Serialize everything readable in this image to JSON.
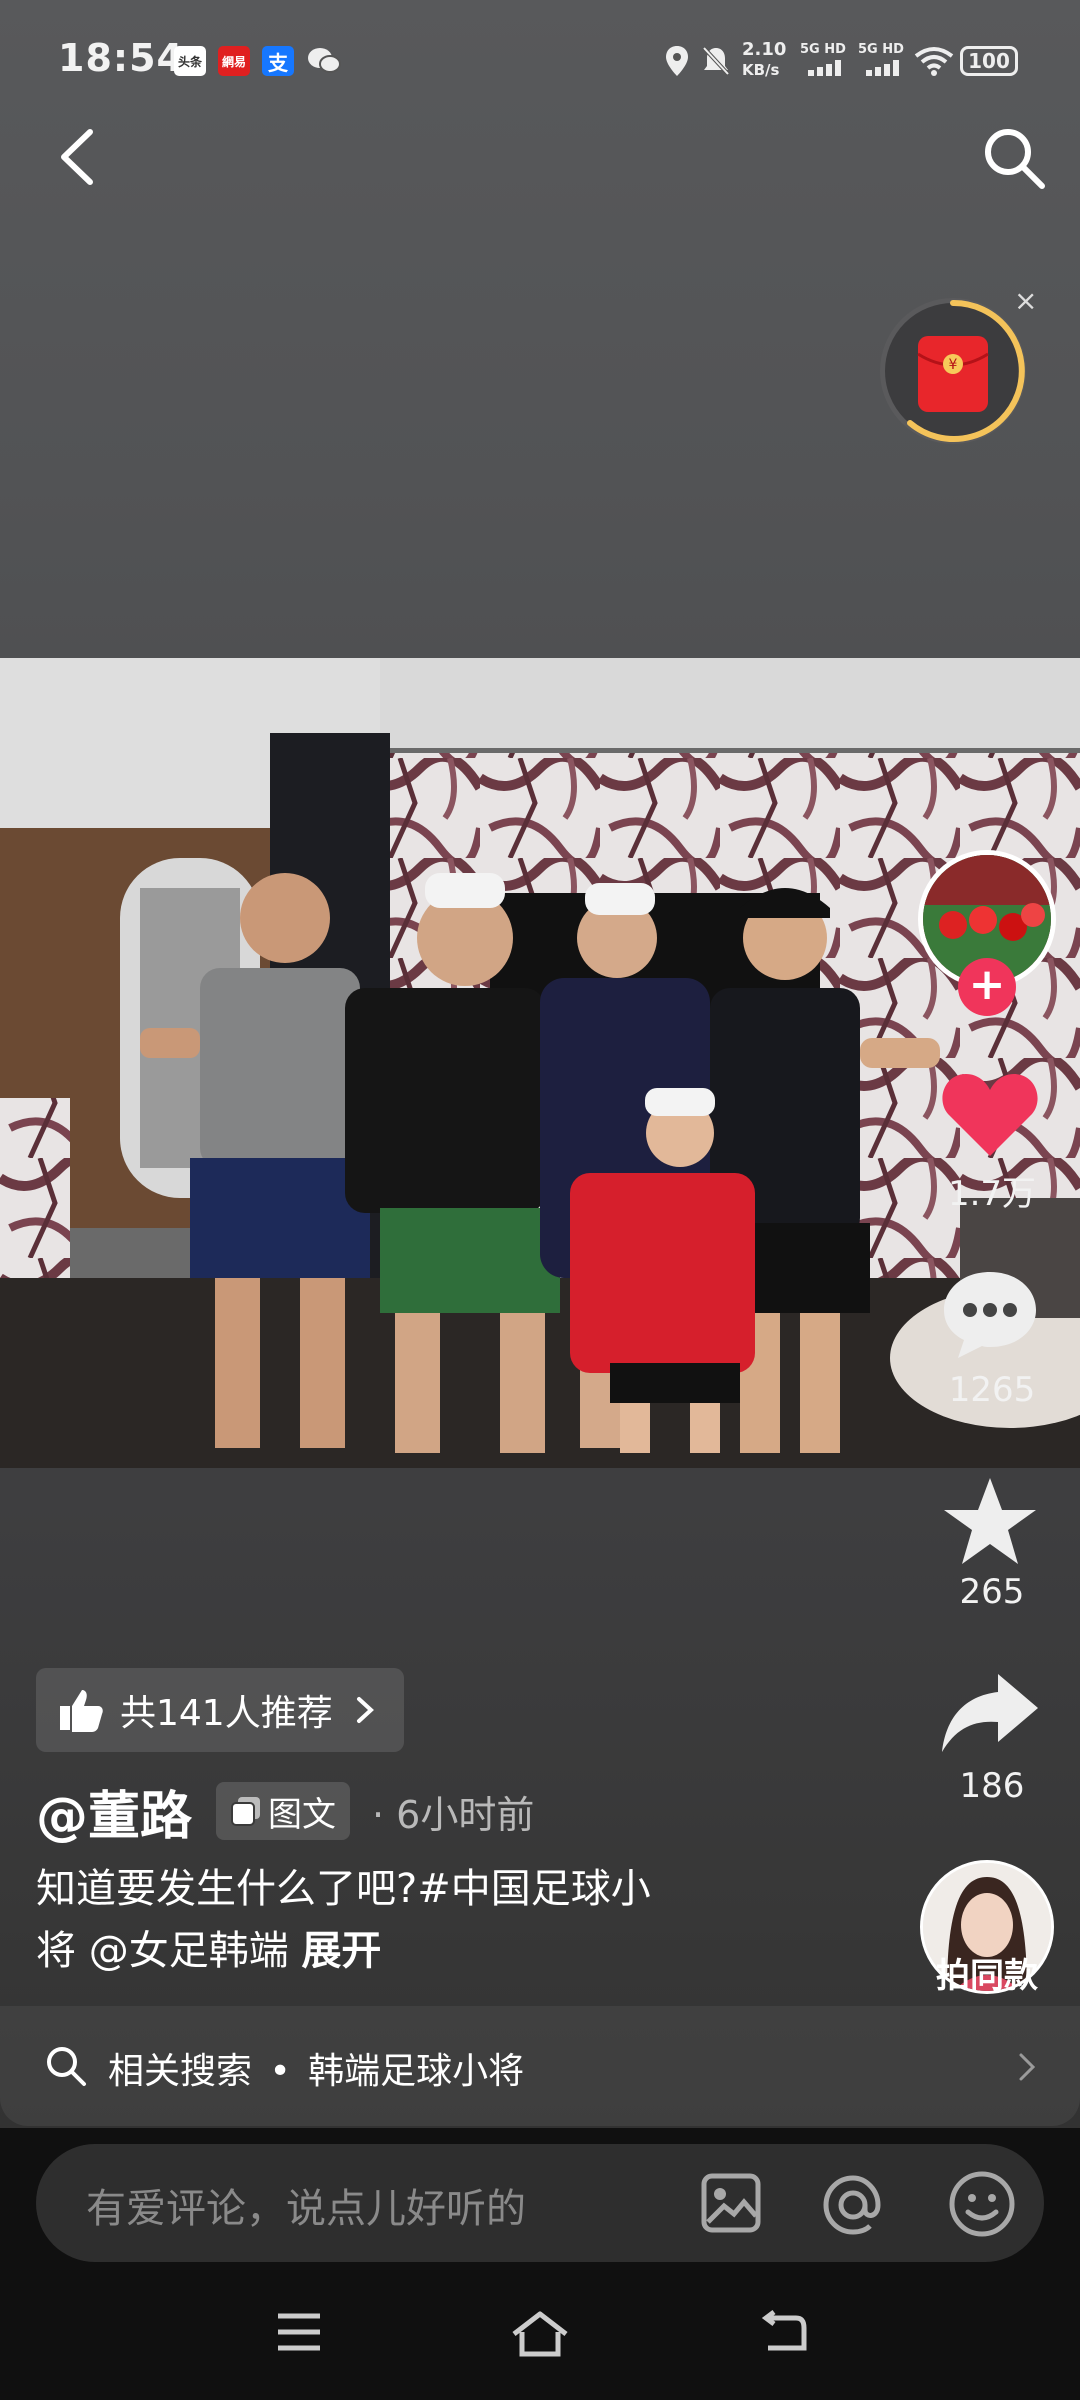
{
  "status_bar": {
    "time": "18:54",
    "apps": [
      {
        "name": "toutiao",
        "label": "头条",
        "bg": "#ffffff",
        "fg": "#333333"
      },
      {
        "name": "netease",
        "label": "網易",
        "bg": "#e02020",
        "fg": "#ffffff"
      },
      {
        "name": "alipay",
        "label": "支",
        "bg": "#1677ff",
        "fg": "#ffffff"
      },
      {
        "name": "wechat",
        "label": "●",
        "bg": "transparent",
        "fg": "#ffffff"
      }
    ],
    "net_speed": "2.10",
    "net_unit": "KB/s",
    "sim1": "5G HD",
    "sim2": "5G HD",
    "battery": "100"
  },
  "related_search": {
    "label": "相关搜索",
    "separator": "•",
    "term": "韩端足球小将"
  },
  "actions": {
    "likes": "1.7万",
    "comments": "1265",
    "favorites": "265",
    "shares": "186"
  },
  "post": {
    "recommend": "共141人推荐",
    "author": "@董路",
    "type_badge": "图文",
    "time_ago": "· 6小时前",
    "caption_line1": "知道要发生什么了吧?#中国足球小",
    "caption_line2": "将 @女足韩端 ",
    "expand": "展开",
    "same_style": "拍同款"
  },
  "comment": {
    "placeholder": "有爱评论，说点儿好听的"
  },
  "colors": {
    "accent": "#f0355b",
    "red_packet": "#e8262b",
    "ring": "#f4c35a"
  }
}
